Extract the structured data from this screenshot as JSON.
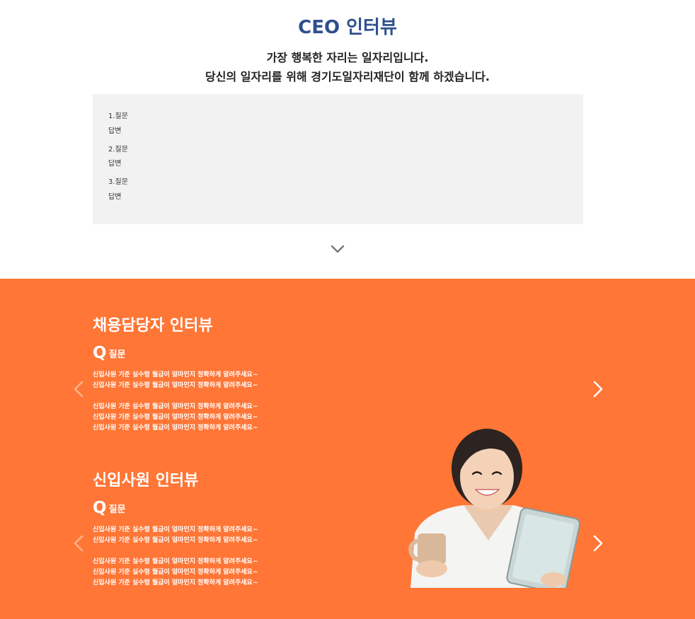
{
  "ceo": {
    "title": "CEO 인터뷰",
    "subtitle_line1": "가장 행복한 자리는 일자리입니다.",
    "subtitle_line2": "당신의 일자리를 위해 경기도일자리재단이 함께 하겠습니다.",
    "qa": [
      {
        "q": "1.질문",
        "a": "답변"
      },
      {
        "q": "2.질문",
        "a": "답변"
      },
      {
        "q": "3.질문",
        "a": "답변"
      }
    ],
    "expand_icon": "chevron-down-icon"
  },
  "recruiter": {
    "title": "채용담당자 인터뷰",
    "q_mark": "Q",
    "q_label": "질문",
    "lines": [
      "신입사원 기준 실수령 월급이 얼마인지 정확하게 알려주세요~",
      "신입사원 기준 실수령 월급이 얼마인지 정확하게 알려주세요~",
      "신입사원 기준 실수령 월급이 얼마인지 정확하게 알려주세요~",
      "신입사원 기준 실수령 월급이 얼마인지 정확하게 알려주세요~",
      "신입사원 기준 실수령 월급이 얼마인지 정확하게 알려주세요~"
    ]
  },
  "newhire": {
    "title": "신입사원 인터뷰",
    "q_mark": "Q",
    "q_label": "질문",
    "lines": [
      "신입사원 기준 실수령 월급이 얼마인지 정확하게 알려주세요~",
      "신입사원 기준 실수령 월급이 얼마인지 정확하게 알려주세요~",
      "신입사원 기준 실수령 월급이 얼마인지 정확하게 알려주세요~",
      "신입사원 기준 실수령 월급이 얼마인지 정확하게 알려주세요~",
      "신입사원 기준 실수령 월급이 얼마인지 정확하게 알려주세요~"
    ]
  },
  "colors": {
    "accent": "#ff7636",
    "title_blue": "#2f4f8f",
    "box_gray": "#f2f2f2"
  },
  "icons": {
    "prev": "chevron-left-icon",
    "next": "chevron-right-icon",
    "photo": "woman-with-cup-and-tablet-photo"
  }
}
